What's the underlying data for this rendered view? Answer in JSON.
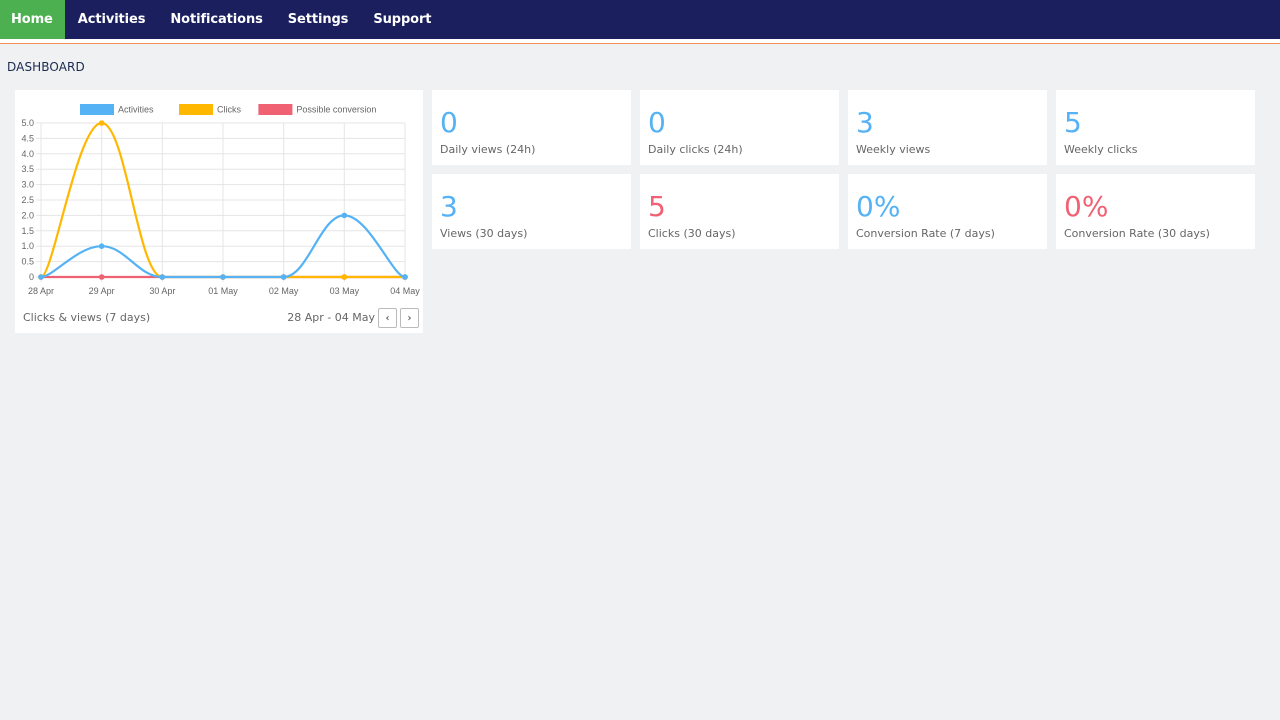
{
  "nav": {
    "items": [
      {
        "label": "Home",
        "active": true
      },
      {
        "label": "Activities",
        "active": false
      },
      {
        "label": "Notifications",
        "active": false
      },
      {
        "label": "Settings",
        "active": false
      },
      {
        "label": "Support",
        "active": false
      }
    ]
  },
  "page": {
    "title": "DASHBOARD"
  },
  "colors": {
    "nav_bg": "#1b1f5e",
    "nav_active": "#4caf50",
    "divider": "#f0905a",
    "blue": "#55b2f5",
    "yellow": "#ffb700",
    "red": "#f06273"
  },
  "chart_panel": {
    "footer_title": "Clicks & views (7 days)",
    "range_label": "28 Apr - 04 May",
    "prev_label": "‹",
    "next_label": "›"
  },
  "chart_data": {
    "type": "line",
    "title": "",
    "xlabel": "",
    "ylabel": "",
    "x": [
      "28 Apr",
      "29 Apr",
      "30 Apr",
      "01 May",
      "02 May",
      "03 May",
      "04 May"
    ],
    "ylim": [
      0,
      5
    ],
    "yticks": [
      "0",
      "0.5",
      "1.0",
      "1.5",
      "2.0",
      "2.5",
      "3.0",
      "3.5",
      "4.0",
      "4.5",
      "5.0"
    ],
    "grid": true,
    "legend_position": "top",
    "series": [
      {
        "name": "Activities",
        "color": "#55b2f5",
        "values": [
          0,
          1,
          0,
          0,
          0,
          2,
          0
        ]
      },
      {
        "name": "Clicks",
        "color": "#ffb700",
        "values": [
          0,
          5,
          0,
          0,
          0,
          0,
          0
        ]
      },
      {
        "name": "Possible conversion",
        "color": "#f06273",
        "values": [
          0,
          0,
          0,
          0,
          0,
          0,
          0
        ]
      }
    ]
  },
  "stats": [
    {
      "value": "0",
      "label": "Daily views (24h)",
      "color": "#55b2f5"
    },
    {
      "value": "0",
      "label": "Daily clicks (24h)",
      "color": "#55b2f5"
    },
    {
      "value": "3",
      "label": "Weekly views",
      "color": "#55b2f5"
    },
    {
      "value": "5",
      "label": "Weekly clicks",
      "color": "#55b2f5"
    },
    {
      "value": "3",
      "label": "Views (30 days)",
      "color": "#55b2f5"
    },
    {
      "value": "5",
      "label": "Clicks (30 days)",
      "color": "#f06273"
    },
    {
      "value": "0%",
      "label": "Conversion Rate (7 days)",
      "color": "#55b2f5"
    },
    {
      "value": "0%",
      "label": "Conversion Rate (30 days)",
      "color": "#f06273"
    }
  ]
}
